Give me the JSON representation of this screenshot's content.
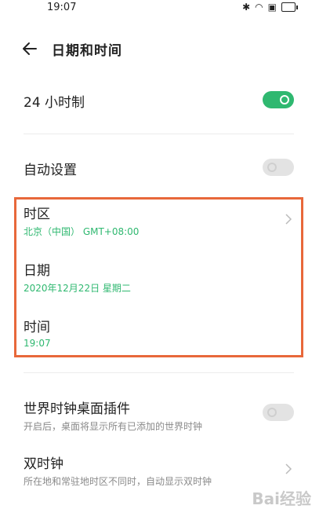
{
  "status_bar": {
    "time": "19:07",
    "icons": [
      "bluetooth-icon",
      "wifi-icon",
      "nfc-icon",
      "battery-icon"
    ]
  },
  "header": {
    "title": "日期和时间",
    "back_icon": "back-arrow-icon"
  },
  "settings": {
    "hour24": {
      "label": "24 小时制",
      "enabled": true
    },
    "auto_set": {
      "label": "自动设置",
      "enabled": false
    },
    "timezone": {
      "label": "时区",
      "value": "北京（中国） GMT+08:00"
    },
    "date": {
      "label": "日期",
      "value": "2020年12月22日 星期二"
    },
    "time": {
      "label": "时间",
      "value": "19:07"
    },
    "world_clock_widget": {
      "label": "世界时钟桌面插件",
      "desc": "开启后，桌面将显示所有已添加的世界时钟",
      "enabled": false
    },
    "dual_clock": {
      "label": "双时钟",
      "desc": "所在地和常驻地时区不同时，自动显示双时钟"
    }
  },
  "colors": {
    "accent": "#2fb870",
    "highlight": "#e8683a"
  },
  "watermark": "Bai经验"
}
